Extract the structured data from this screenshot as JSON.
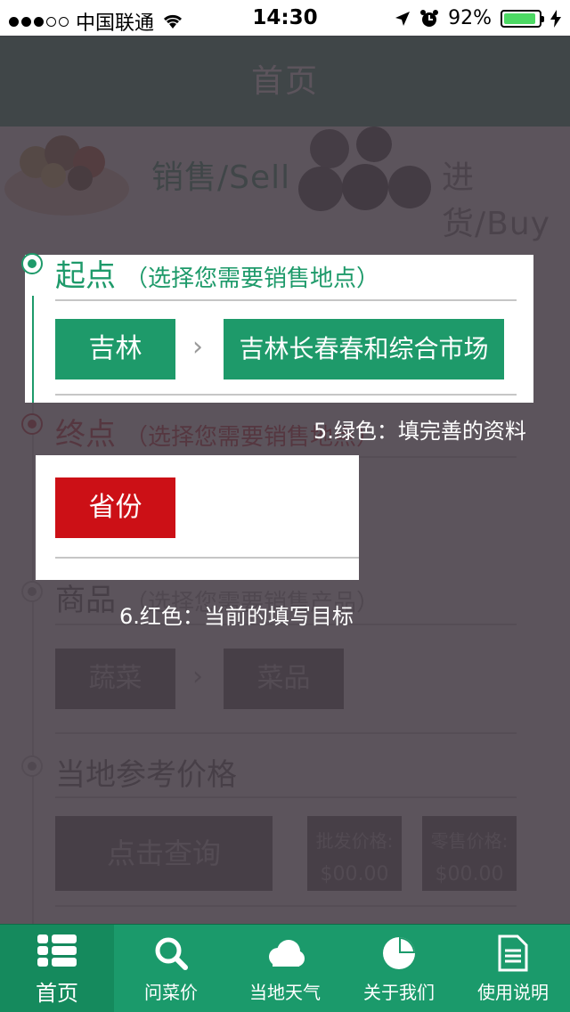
{
  "status_bar": {
    "carrier": "中国联通",
    "time": "14:30",
    "battery": "92%",
    "battery_level": 0.92
  },
  "header": {
    "title": "首页"
  },
  "banner": {
    "sell": "销售/Sell",
    "buy": "进货/Buy"
  },
  "sections": {
    "origin": {
      "title": "起点",
      "hint": "（选择您需要销售地点）",
      "province_button": "吉林",
      "market_button": "吉林长春春和综合市场"
    },
    "destination": {
      "title": "终点",
      "hint": "（选择您需要销售地点）",
      "province_button": "省份"
    },
    "product": {
      "title": "商品",
      "hint": "（选择您需要销售产品）",
      "category_button": "蔬菜",
      "item_button": "菜品"
    },
    "price": {
      "title": "当地参考价格",
      "query_button": "点击查询",
      "wholesale_label": "批发价格:",
      "wholesale_value": "$00.00",
      "retail_label": "零售价格:",
      "retail_value": "$00.00"
    }
  },
  "tips": {
    "green_tip": "5.绿色：填完善的资料",
    "red_tip": "6.红色：当前的填写目标"
  },
  "tabs": [
    {
      "label": "首页",
      "icon": "list-icon"
    },
    {
      "label": "问菜价",
      "icon": "search-icon"
    },
    {
      "label": "当地天气",
      "icon": "cloud-icon"
    },
    {
      "label": "关于我们",
      "icon": "pie-chart-icon"
    },
    {
      "label": "使用说明",
      "icon": "document-icon"
    }
  ],
  "colors": {
    "accent_green": "#1e9a6a",
    "accent_red": "#cc1016",
    "overlay": "#463c46"
  }
}
